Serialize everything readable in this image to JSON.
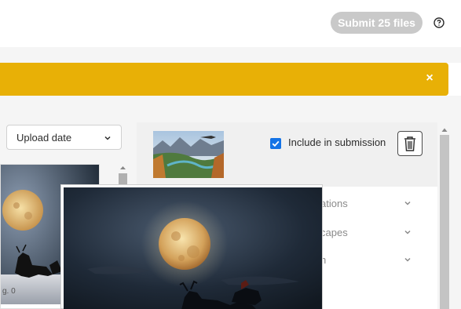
{
  "header": {
    "submit_label": "Submit 25 files",
    "help_icon": "question-circle-icon"
  },
  "banner": {
    "color": "#e8b006",
    "close_icon": "close-icon"
  },
  "toolbar": {
    "sort_value": "Upload date"
  },
  "grid": {
    "card_meta": "g. 0"
  },
  "detail": {
    "include_label": "Include in submission",
    "include_checked": true,
    "accordion": [
      {
        "label": "ations"
      },
      {
        "label": "capes"
      },
      {
        "label": "h"
      }
    ]
  },
  "colors": {
    "accent": "#1473e6",
    "submit_disabled": "#c9c9c9"
  }
}
